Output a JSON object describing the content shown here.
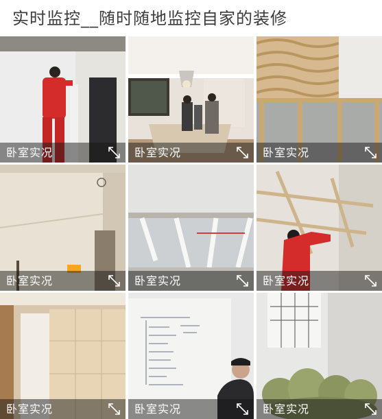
{
  "header": {
    "title": "实时监控__随时随地监控自家的装修"
  },
  "tiles": [
    {
      "label": "卧室实况",
      "scene": "worker-by-wall"
    },
    {
      "label": "卧室实况",
      "scene": "ceiling-lamp-room"
    },
    {
      "label": "卧室实况",
      "scene": "wood-wall-frame"
    },
    {
      "label": "卧室实况",
      "scene": "empty-room-corner"
    },
    {
      "label": "卧室实况",
      "scene": "ceiling-joists"
    },
    {
      "label": "卧室实况",
      "scene": "worker-on-ladder"
    },
    {
      "label": "卧室实况",
      "scene": "wood-panel-wall"
    },
    {
      "label": "卧室实况",
      "scene": "whiteboard-meeting"
    },
    {
      "label": "卧室实况",
      "scene": "rubble-bags"
    }
  ],
  "icons": {
    "expand": "expand-arrows-icon"
  }
}
